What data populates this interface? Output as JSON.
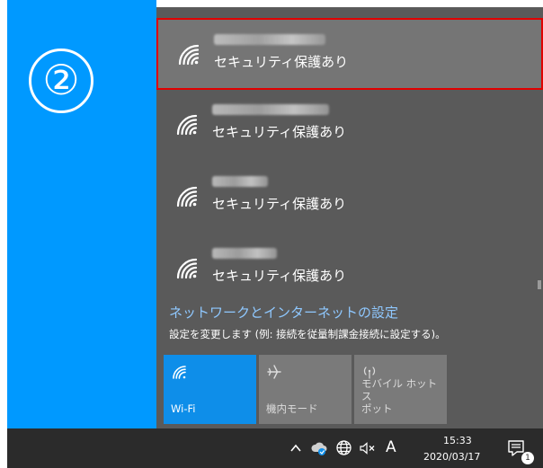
{
  "step_marker": "②",
  "networks": [
    {
      "ssid_blurred": true,
      "security": "セキュリティ保護あり",
      "selected": true
    },
    {
      "ssid_blurred": true,
      "security": "セキュリティ保護あり",
      "selected": false
    },
    {
      "ssid_blurred": true,
      "security": "セキュリティ保護あり",
      "selected": false
    },
    {
      "ssid_blurred": true,
      "security": "セキュリティ保護あり",
      "selected": false
    }
  ],
  "settings": {
    "link": "ネットワークとインターネットの設定",
    "description": "設定を変更します (例: 接続を従量制課金接続に設定する)。"
  },
  "quick_actions": [
    {
      "label": "Wi-Fi",
      "icon": "wifi-icon",
      "active": true
    },
    {
      "label": "機内モード",
      "icon": "airplane-icon",
      "active": false
    },
    {
      "label": "モバイル ホットスポット",
      "label_line1": "モバイル ホットス",
      "label_line2": "ポット",
      "icon": "hotspot-icon",
      "active": false
    }
  ],
  "taskbar": {
    "ime": "A",
    "time": "15:33",
    "date": "2020/03/17",
    "notifications": "1"
  },
  "colors": {
    "accent_blue": "#0099ff",
    "panel_bg": "#5a5a5a",
    "selected_bg": "#757575",
    "highlight_border": "#e00000",
    "link_color": "#8fc8ff",
    "tile_on": "#0e8ee9",
    "tile_off": "#7a7a7a",
    "taskbar_bg": "#2b2b2b"
  }
}
